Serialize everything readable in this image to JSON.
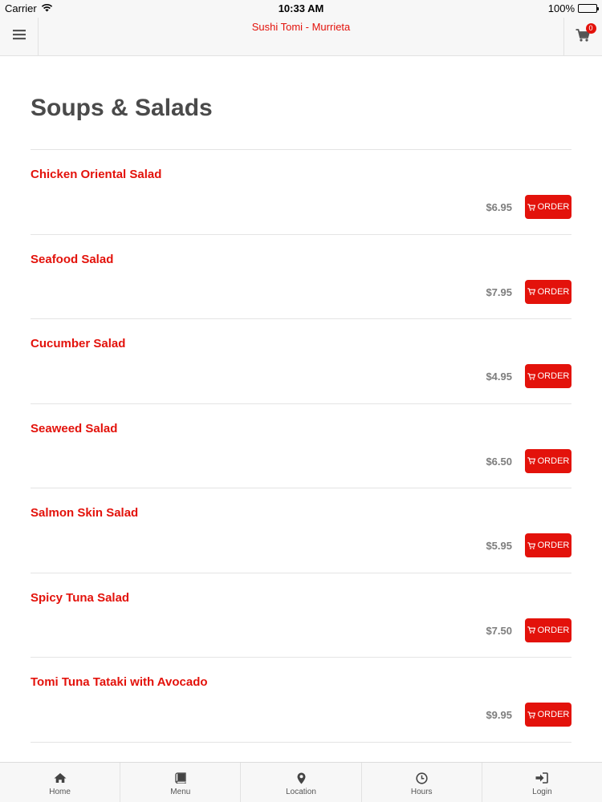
{
  "status_bar": {
    "carrier": "Carrier",
    "time": "10:33 AM",
    "battery": "100%"
  },
  "header": {
    "title": "Sushi Tomi - Murrieta",
    "cart_count": "0"
  },
  "section": {
    "title": "Soups & Salads"
  },
  "order_label": "ORDER",
  "items": [
    {
      "name": "Chicken Oriental Salad",
      "price": "$6.95"
    },
    {
      "name": "Seafood Salad",
      "price": "$7.95"
    },
    {
      "name": "Cucumber Salad",
      "price": "$4.95"
    },
    {
      "name": "Seaweed Salad",
      "price": "$6.50"
    },
    {
      "name": "Salmon Skin Salad",
      "price": "$5.95"
    },
    {
      "name": "Spicy Tuna Salad",
      "price": "$7.50"
    },
    {
      "name": "Tomi Tuna Tataki with Avocado",
      "price": "$9.95"
    }
  ],
  "tabs": [
    {
      "label": "Home",
      "icon": "home-icon"
    },
    {
      "label": "Menu",
      "icon": "book-icon"
    },
    {
      "label": "Location",
      "icon": "map-marker-icon"
    },
    {
      "label": "Hours",
      "icon": "clock-icon"
    },
    {
      "label": "Login",
      "icon": "sign-in-icon"
    }
  ],
  "colors": {
    "accent": "#e3120b",
    "title_gray": "#4a4a4a",
    "price_gray": "#7d7d7d",
    "bar_background": "#f7f7f7"
  }
}
